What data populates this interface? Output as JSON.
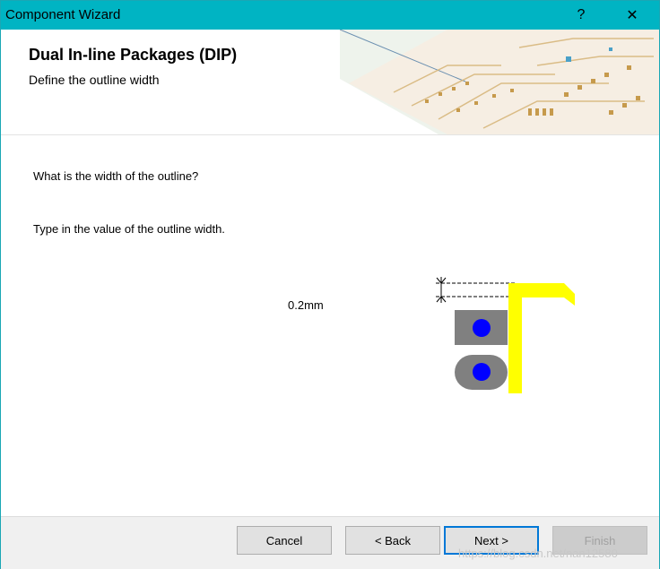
{
  "window": {
    "title": "Component Wizard",
    "help_glyph": "?",
    "close_glyph": "✕"
  },
  "header": {
    "heading": "Dual In-line Packages (DIP)",
    "subheading": "Define the outline width"
  },
  "content": {
    "question": "What is the width of the outline?",
    "instruction": "Type in the value of the outline width.",
    "outline_width_value": "0.2mm"
  },
  "buttons": {
    "cancel": "Cancel",
    "back": "< Back",
    "next": "Next >",
    "finish": "Finish"
  },
  "watermark": "https://blog.csdn.net/nan12580",
  "colors": {
    "titlebar": "#00b4c3",
    "outline": "#ffff00",
    "pad": "#808080",
    "hole": "#0000ff",
    "default_button_border": "#0078d7"
  }
}
